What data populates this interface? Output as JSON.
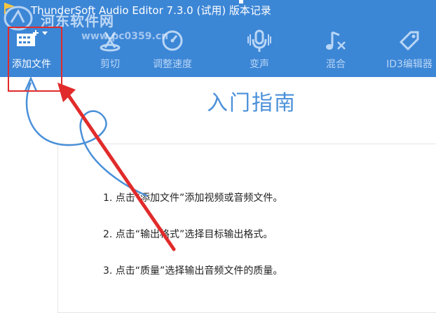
{
  "window": {
    "title": "ThunderSoft Audio Editor 7.3.0 (试用) 版本记录"
  },
  "watermark": {
    "site_name": "河东软件网",
    "url": "www.pc0359.cn"
  },
  "toolbar": {
    "items": [
      {
        "label": "添加文件",
        "icon": "add-file-icon",
        "active": true
      },
      {
        "label": "剪切",
        "icon": "cut-icon"
      },
      {
        "label": "调整速度",
        "icon": "speed-gauge-icon"
      },
      {
        "label": "变声",
        "icon": "microphone-icon"
      },
      {
        "label": "混合",
        "icon": "music-note-icon"
      },
      {
        "label": "ID3编辑器",
        "icon": "tag-icon"
      }
    ]
  },
  "guide": {
    "title": "入门指南",
    "steps": [
      "1. 点击“添加文件”添加视频或音频文件。",
      "2. 点击“输出格式”选择目标输出格式。",
      "3. 点击“质量”选择输出音频文件的质量。"
    ]
  },
  "colors": {
    "toolbar_bg": "#3c86d6",
    "annotation_red": "#e12b2b",
    "guide_blue": "#4a90d9"
  }
}
